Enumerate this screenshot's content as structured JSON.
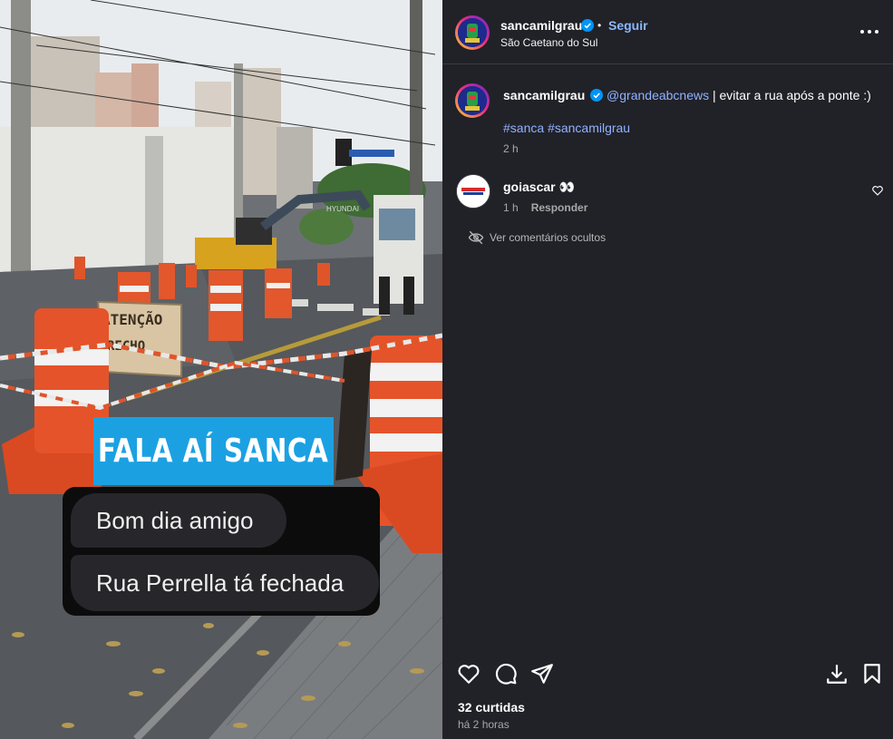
{
  "post": {
    "image": {
      "overlay_title": "FALA AÍ SANCA",
      "message_1": "Bom dia amigo",
      "message_2": "Rua Perrella tá fechada",
      "sign_text_1": "ATENÇÃO",
      "sign_text_2": "RECHO",
      "sign_brand": "HYUNDAI"
    },
    "header": {
      "username": "sancamilgrau",
      "separator": "•",
      "follow_label": "Seguir",
      "location": "São Caetano do Sul"
    },
    "caption": {
      "username": "sancamilgrau",
      "mention": "@grandeabcnews",
      "text": " | evitar a rua após a ponte :)",
      "hashtag_1": "#sanca",
      "hashtag_2": "#sancamilgrau",
      "time": "2 h"
    },
    "comments": [
      {
        "username": "goiascar",
        "text": "👀",
        "time": "1 h",
        "reply_label": "Responder"
      }
    ],
    "hidden_comments_label": "Ver comentários ocultos",
    "likes": "32 curtidas",
    "posted_ago": "há 2 horas"
  },
  "icons": {
    "more": "more-options-icon",
    "verified": "verified-badge-icon",
    "like": "heart-icon",
    "comment": "comment-icon",
    "share": "send-icon",
    "download": "download-icon",
    "save": "bookmark-icon",
    "eye_off": "eye-off-icon"
  },
  "colors": {
    "panel_bg": "#212128",
    "accent_link": "#8bb8ff",
    "overlay_blue": "#1ba1e2",
    "verified_blue": "#0095f6"
  }
}
